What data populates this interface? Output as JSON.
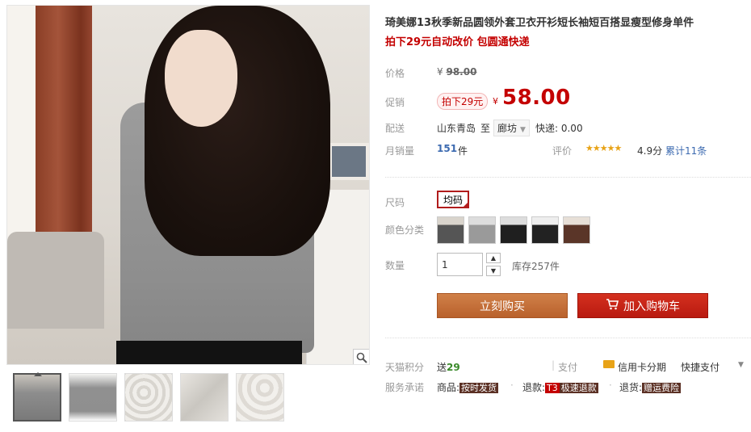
{
  "product": {
    "title": "琦美娜13秋季新品圆领外套卫衣开衫短长袖短百搭显瘦型修身单件",
    "subtitle": "拍下29元自动改价 包圆通快递"
  },
  "price": {
    "label": "价格",
    "currency": "¥",
    "original": "98.00"
  },
  "promo": {
    "label": "促销",
    "tag": "拍下29元",
    "currency": "¥",
    "price": "58.00"
  },
  "shipping": {
    "label": "配送",
    "from": "山东青岛",
    "to_word": "至",
    "city": "廊坊",
    "fee": "快递: 0.00"
  },
  "sales": {
    "label": "月销量",
    "count": "151",
    "unit": "件",
    "rating_label": "评价",
    "stars": "★★★★★",
    "score": "4.9分",
    "reviews": "累计11条"
  },
  "size": {
    "label": "尺码",
    "selected": "均码"
  },
  "color": {
    "label": "颜色分类",
    "swatch_count": 5
  },
  "quantity": {
    "label": "数量",
    "value": "1",
    "stock": "库存257件"
  },
  "actions": {
    "buy": "立刻购买",
    "cart": "加入购物车"
  },
  "points": {
    "label": "天猫积分",
    "prefix": "送",
    "value": "29",
    "pay_label": "支付",
    "card": "信用卡分期",
    "quick": "快捷支付"
  },
  "promise": {
    "label": "服务承诺",
    "goods_label": "商品:",
    "goods_tag": "按时发货",
    "refund_label": "退款:",
    "refund_badge": "T3",
    "refund_tag": "极速退款",
    "return_label": "退货:",
    "return_tag": "赠运费险"
  },
  "colors": {
    "accent_red": "#c40000",
    "buy_orange": "#c4713b",
    "cart_red": "#c8281a",
    "link_blue": "#3c6ab0"
  },
  "icons": {
    "zoom": "magnifier-icon",
    "cart": "cart-icon",
    "card": "credit-card-icon"
  }
}
